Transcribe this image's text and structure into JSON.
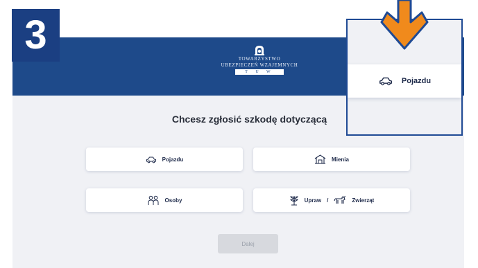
{
  "logo": {
    "line1": "TOWARZYSTWO",
    "line2": "UBEZPIECZEŃ WZAJEMNYCH",
    "line3": "T U W"
  },
  "question": "Chcesz zgłosić szkodę dotyczącą",
  "options": {
    "vehicle": "Pojazdu",
    "property": "Mienia",
    "persons": "Osoby",
    "crops": "Upraw",
    "separator": "/",
    "animals": "Zwierząt"
  },
  "next_button": "Dalej",
  "step_number": "3",
  "zoom": {
    "label": "Pojazdu"
  },
  "colors": {
    "header_blue": "#1e4a8a",
    "badge_blue": "#1b3f82",
    "arrow_orange": "#f08a1c",
    "panel_gray": "#f0f1f5"
  }
}
